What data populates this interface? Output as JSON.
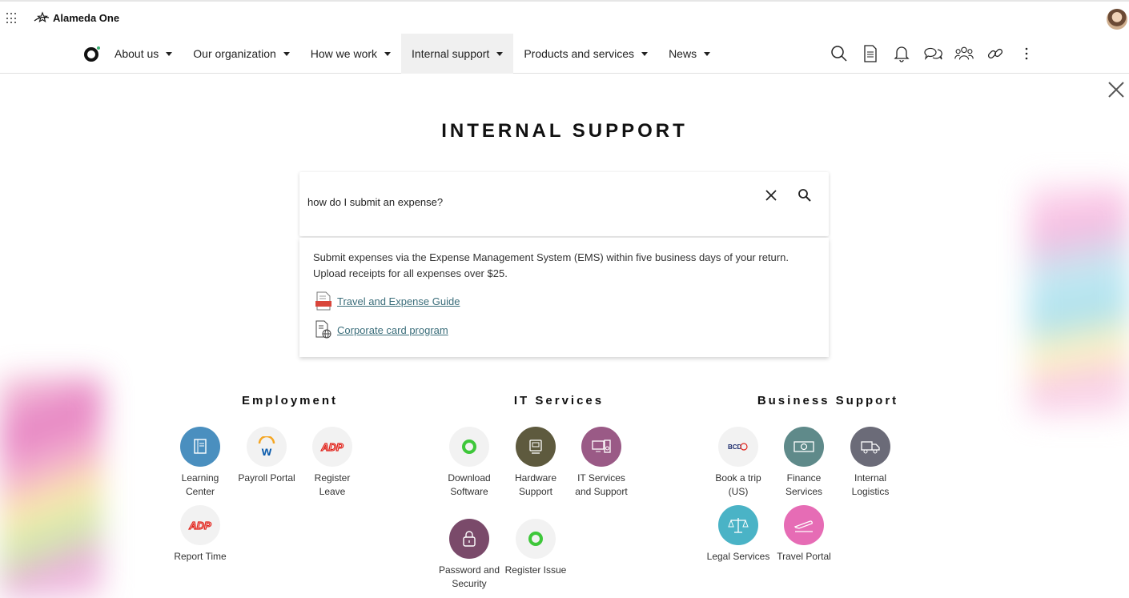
{
  "header": {
    "brand": "Alameda One"
  },
  "nav": {
    "items": [
      {
        "label": "About us",
        "active": false
      },
      {
        "label": "Our organization",
        "active": false
      },
      {
        "label": "How we work",
        "active": false
      },
      {
        "label": "Internal support",
        "active": true
      },
      {
        "label": "Products and services",
        "active": false
      },
      {
        "label": "News",
        "active": false
      }
    ],
    "tools": [
      "search-icon",
      "document-icon",
      "bell-icon",
      "chat-icon",
      "people-icon",
      "link-icon",
      "more-vertical-icon"
    ]
  },
  "page": {
    "title": "INTERNAL SUPPORT"
  },
  "search": {
    "value": "how do I submit an expense?"
  },
  "answer": {
    "text": "Submit expenses via the Expense Management System (EMS) within five business days of your return. Upload receipts for all expenses over $25.",
    "links": [
      {
        "label": "Travel and Expense Guide",
        "icon": "pdf-document-icon"
      },
      {
        "label": "Corporate card program",
        "icon": "web-document-icon"
      }
    ]
  },
  "sections": {
    "employment": {
      "title": "Employment",
      "tiles": [
        {
          "label": "Learning Center",
          "icon": "book-icon",
          "color": "#4a8fbf"
        },
        {
          "label": "Payroll Portal",
          "icon": "workday-icon",
          "color": "#f2f2f2"
        },
        {
          "label": "Register Leave",
          "icon": "adp-icon",
          "color": "#f2f2f2"
        },
        {
          "label": "Report Time",
          "icon": "adp-icon",
          "color": "#f2f2f2"
        }
      ]
    },
    "it": {
      "title": "IT Services",
      "tiles": [
        {
          "label": "Download Software",
          "icon": "ring-icon",
          "color": "#f2f2f2"
        },
        {
          "label": "Hardware Support",
          "icon": "monitor-icon",
          "color": "#5e5a3e"
        },
        {
          "label": "IT Services and Support",
          "icon": "computer-icon",
          "color": "#9a5a86"
        },
        {
          "label": "Password and Security",
          "icon": "lock-icon",
          "color": "#7a4a6a"
        },
        {
          "label": "Register Issue",
          "icon": "ring-icon",
          "color": "#f2f2f2"
        }
      ]
    },
    "business": {
      "title": "Business Support",
      "tiles": [
        {
          "label": "Book a trip (US)",
          "icon": "bcd-travel-icon",
          "color": "#f2f2f2"
        },
        {
          "label": "Finance Services",
          "icon": "banknote-icon",
          "color": "#5f8a8a"
        },
        {
          "label": "Internal Logistics",
          "icon": "truck-icon",
          "color": "#6b6b78"
        },
        {
          "label": "Legal Services",
          "icon": "scales-icon",
          "color": "#4ab3c6"
        },
        {
          "label": "Travel Portal",
          "icon": "plane-icon",
          "color": "#e66cb5"
        }
      ]
    }
  }
}
